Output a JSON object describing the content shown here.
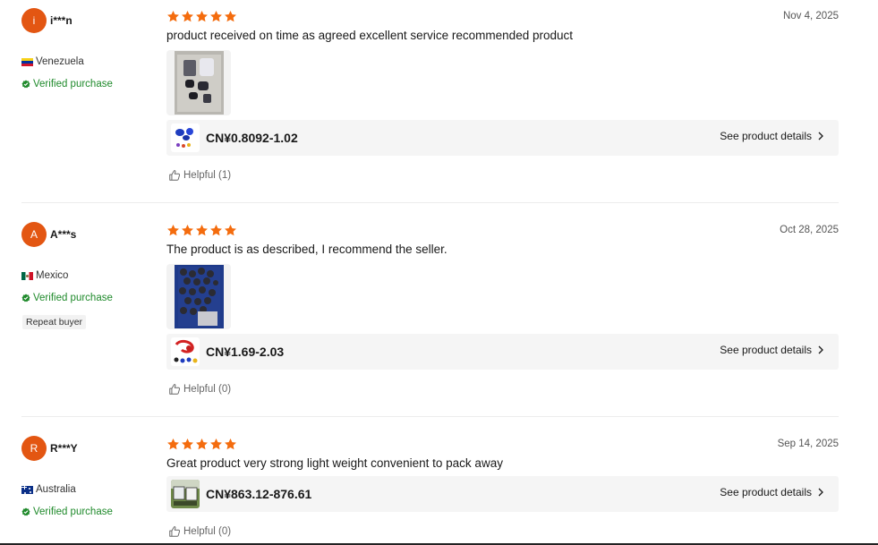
{
  "reviews": [
    {
      "avatar_letter": "i",
      "username": "i***n",
      "country": "Venezuela",
      "flag": "venezuela-flag-icon",
      "verified_label": "Verified purchase",
      "repeat_buyer": "",
      "rating": 5,
      "date": "Nov 4, 2025",
      "text": "product received on time as agreed excellent service recommended product",
      "has_photo": true,
      "price": "CN¥0.8092-1.02",
      "details_label": "See product details",
      "helpful_label": "Helpful (1)"
    },
    {
      "avatar_letter": "A",
      "username": "A***s",
      "country": "Mexico",
      "flag": "mexico-flag-icon",
      "verified_label": "Verified purchase",
      "repeat_buyer": "Repeat buyer",
      "rating": 5,
      "date": "Oct 28, 2025",
      "text": "The product is as described, I recommend the seller.",
      "has_photo": true,
      "price": "CN¥1.69-2.03",
      "details_label": "See product details",
      "helpful_label": "Helpful (0)"
    },
    {
      "avatar_letter": "R",
      "username": "R***Y",
      "country": "Australia",
      "flag": "australia-flag-icon",
      "verified_label": "Verified purchase",
      "repeat_buyer": "",
      "rating": 5,
      "date": "Sep 14, 2025",
      "text": "Great product very strong light weight convenient to pack away",
      "has_photo": false,
      "price": "CN¥863.12-876.61",
      "details_label": "See product details",
      "helpful_label": "Helpful (0)"
    }
  ],
  "colors": {
    "star": "#f46c0e",
    "avatar": "#e35612",
    "verified": "#1f8a2b"
  }
}
